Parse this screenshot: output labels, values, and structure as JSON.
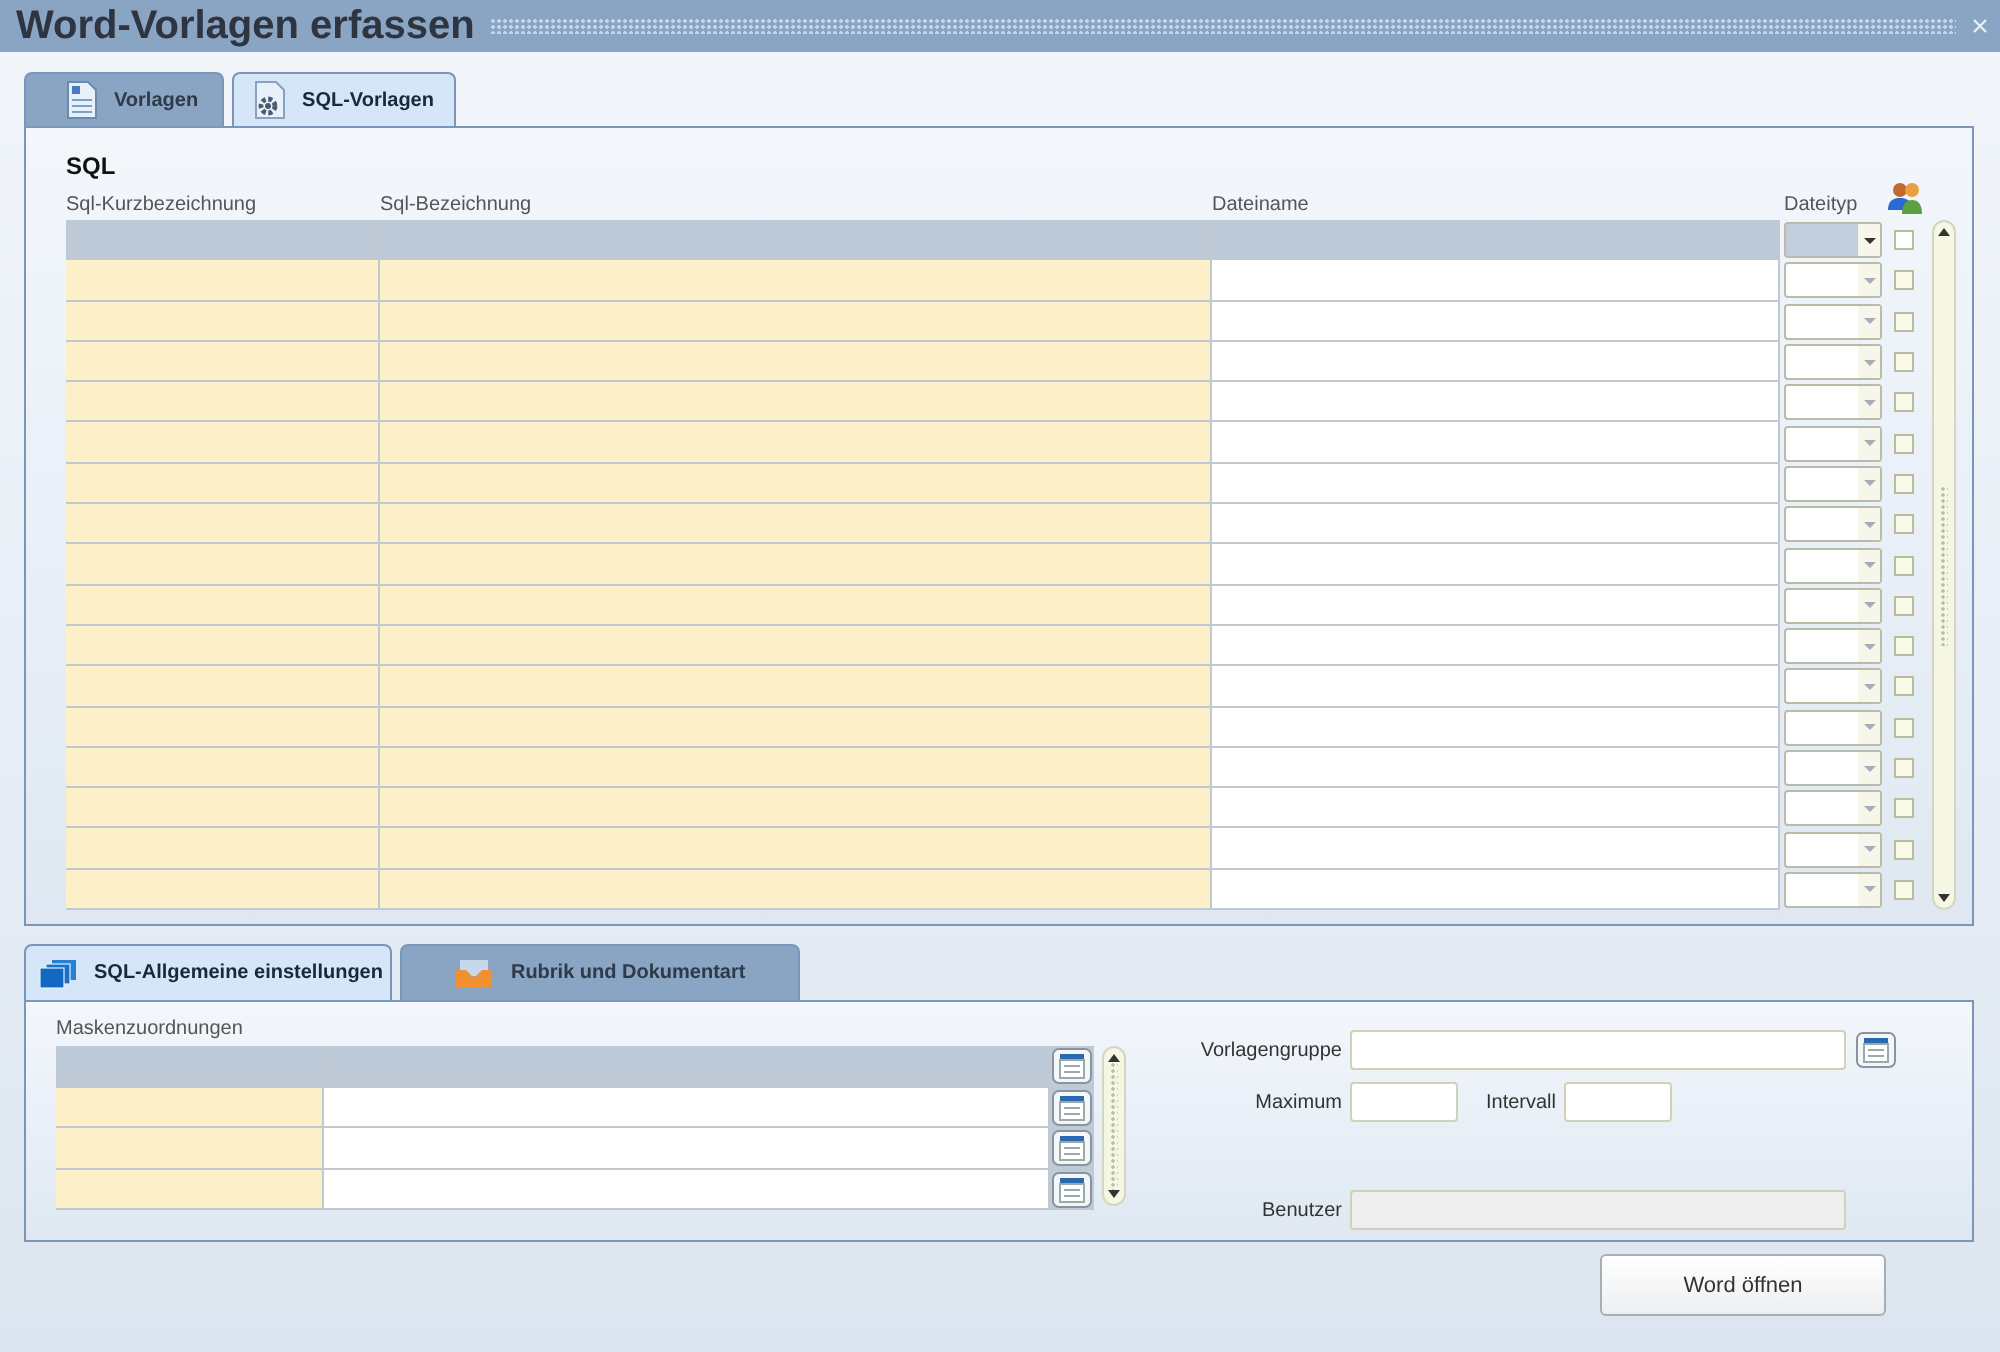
{
  "window": {
    "title": "Word-Vorlagen erfassen"
  },
  "tabs": [
    {
      "label": "Vorlagen",
      "selected": false
    },
    {
      "label": "SQL-Vorlagen",
      "selected": true
    }
  ],
  "sql_section": {
    "title": "SQL",
    "columns": [
      "Sql-Kurzbezeichnung",
      "Sql-Bezeichnung",
      "Dateiname",
      "Dateityp"
    ],
    "rows": [
      {
        "selected": true,
        "checked": false
      },
      {
        "selected": false,
        "checked": false
      },
      {
        "selected": false,
        "checked": false
      },
      {
        "selected": false,
        "checked": false
      },
      {
        "selected": false,
        "checked": false
      },
      {
        "selected": false,
        "checked": false
      },
      {
        "selected": false,
        "checked": false
      },
      {
        "selected": false,
        "checked": false
      },
      {
        "selected": false,
        "checked": false
      },
      {
        "selected": false,
        "checked": false
      },
      {
        "selected": false,
        "checked": false
      },
      {
        "selected": false,
        "checked": false
      },
      {
        "selected": false,
        "checked": false
      },
      {
        "selected": false,
        "checked": false
      },
      {
        "selected": false,
        "checked": false
      },
      {
        "selected": false,
        "checked": false
      },
      {
        "selected": false,
        "checked": false
      }
    ]
  },
  "lower_tabs": [
    {
      "label": "SQL-Allgemeine einstellungen",
      "selected": true
    },
    {
      "label": "Rubrik und Dokumentart",
      "selected": false
    }
  ],
  "mask_assignments": {
    "label": "Maskenzuordnungen",
    "rows": [
      {
        "selected": true
      },
      {
        "selected": false
      },
      {
        "selected": false
      },
      {
        "selected": false
      }
    ]
  },
  "form": {
    "template_group": {
      "label": "Vorlagengruppe"
    },
    "maximum": {
      "label": "Maximum"
    },
    "interval": {
      "label": "Intervall"
    },
    "user": {
      "label": "Benutzer",
      "disabled": true
    }
  },
  "buttons": [
    {
      "label": "Word öffnen"
    }
  ]
}
